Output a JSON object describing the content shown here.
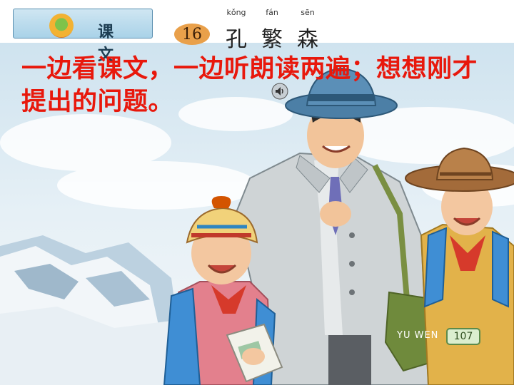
{
  "header": {
    "section_label": "课 文",
    "lesson_number": "16",
    "title_pinyin": [
      "kǒng",
      "fán",
      "sēn"
    ],
    "title_chars": [
      "孔",
      "繁",
      "森"
    ]
  },
  "instruction": "一边看课文，一边听朗读两遍；想想刚才提出的问题。",
  "footer": {
    "book_code": "YU WEN",
    "page_number": "107"
  },
  "icons": {
    "speaker": "speaker-icon",
    "emblem": "textbook-emblem-icon"
  },
  "colors": {
    "instruction_text": "#e8180c",
    "header_tab": "#a9d2e8",
    "lesson_badge": "#e9a04a"
  }
}
